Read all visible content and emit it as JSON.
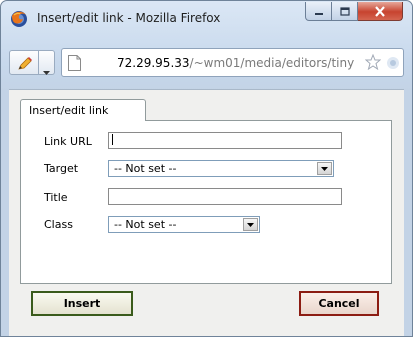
{
  "window": {
    "title": "Insert/edit link - Mozilla Firefox"
  },
  "icons": {
    "app": "firefox-icon",
    "minimize": "minimize-icon",
    "maximize": "maximize-icon",
    "close": "close-icon",
    "edit": "pencil-icon",
    "dropdown": "chevron-down-icon",
    "page": "page-icon",
    "bookmark": "star-icon",
    "feed": "feed-icon"
  },
  "urlbar": {
    "host": "72.29.95.33",
    "path": "/~wm01/media/editors/tiny"
  },
  "tabs": [
    {
      "label": "Insert/edit link"
    }
  ],
  "form": {
    "link_url": {
      "label": "Link URL",
      "value": ""
    },
    "target": {
      "label": "Target",
      "value": "-- Not set --"
    },
    "title": {
      "label": "Title",
      "value": ""
    },
    "class": {
      "label": "Class",
      "value": "-- Not set --"
    }
  },
  "buttons": {
    "insert": "Insert",
    "cancel": "Cancel"
  },
  "colors": {
    "insert_border": "#3a5b1b",
    "cancel_border": "#8c1c12",
    "close_button": "#c7432f"
  }
}
